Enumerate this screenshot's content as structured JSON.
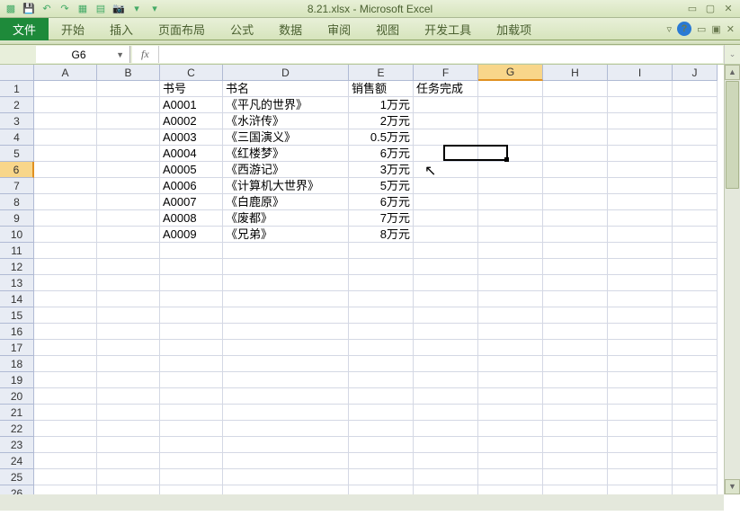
{
  "titlebar": {
    "title": "8.21.xlsx - Microsoft Excel"
  },
  "ribbon": {
    "file": "文件",
    "tabs": [
      "开始",
      "插入",
      "页面布局",
      "公式",
      "数据",
      "审阅",
      "视图",
      "开发工具",
      "加载项"
    ]
  },
  "namebox": "G6",
  "fx_label": "fx",
  "columns": [
    "A",
    "B",
    "C",
    "D",
    "E",
    "F",
    "G",
    "H",
    "I",
    "J"
  ],
  "row_count": 26,
  "active_col": "G",
  "active_row": 6,
  "headers": {
    "C": "书号",
    "D": "书名",
    "E": "销售额",
    "F": "任务完成"
  },
  "rows": [
    {
      "C": "A0001",
      "D": "《平凡的世界》",
      "E": "1万元"
    },
    {
      "C": "A0002",
      "D": "《水浒传》",
      "E": "2万元"
    },
    {
      "C": "A0003",
      "D": "《三国演义》",
      "E": "0.5万元"
    },
    {
      "C": "A0004",
      "D": "《红楼梦》",
      "E": "6万元"
    },
    {
      "C": "A0005",
      "D": "《西游记》",
      "E": "3万元"
    },
    {
      "C": "A0006",
      "D": "《计算机大世界》",
      "E": "5万元"
    },
    {
      "C": "A0007",
      "D": "《白鹿原》",
      "E": "6万元"
    },
    {
      "C": "A0008",
      "D": "《废都》",
      "E": "7万元"
    },
    {
      "C": "A0009",
      "D": "《兄弟》",
      "E": "8万元"
    }
  ]
}
